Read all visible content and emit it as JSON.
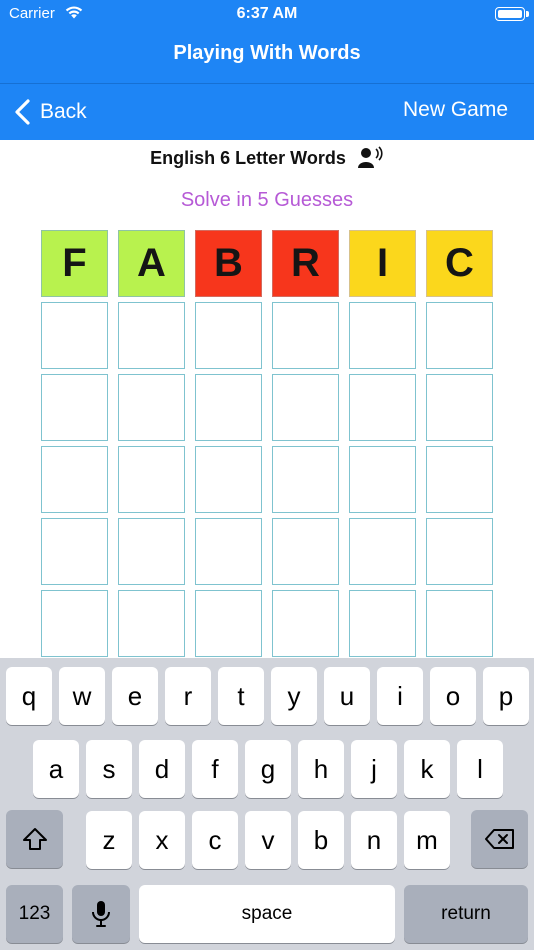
{
  "status_bar": {
    "carrier": "Carrier",
    "time": "6:37 AM"
  },
  "app": {
    "title": "Playing With Words"
  },
  "nav": {
    "back_label": "Back",
    "new_game_label": "New Game"
  },
  "game": {
    "subtitle": "English 6 Letter Words",
    "guesses_text": "Solve in 5 Guesses",
    "colors": {
      "green": "#b8f24e",
      "red": "#f7361c",
      "yellow": "#fbd71c",
      "accent": "#1e85f5",
      "guess_text": "#b65ad6"
    },
    "rows": [
      [
        {
          "letter": "F",
          "state": "green"
        },
        {
          "letter": "A",
          "state": "green"
        },
        {
          "letter": "B",
          "state": "red"
        },
        {
          "letter": "R",
          "state": "red"
        },
        {
          "letter": "I",
          "state": "yellow"
        },
        {
          "letter": "C",
          "state": "yellow"
        }
      ],
      [
        {
          "letter": "",
          "state": "empty"
        },
        {
          "letter": "",
          "state": "empty"
        },
        {
          "letter": "",
          "state": "empty"
        },
        {
          "letter": "",
          "state": "empty"
        },
        {
          "letter": "",
          "state": "empty"
        },
        {
          "letter": "",
          "state": "empty"
        }
      ],
      [
        {
          "letter": "",
          "state": "empty"
        },
        {
          "letter": "",
          "state": "empty"
        },
        {
          "letter": "",
          "state": "empty"
        },
        {
          "letter": "",
          "state": "empty"
        },
        {
          "letter": "",
          "state": "empty"
        },
        {
          "letter": "",
          "state": "empty"
        }
      ],
      [
        {
          "letter": "",
          "state": "empty"
        },
        {
          "letter": "",
          "state": "empty"
        },
        {
          "letter": "",
          "state": "empty"
        },
        {
          "letter": "",
          "state": "empty"
        },
        {
          "letter": "",
          "state": "empty"
        },
        {
          "letter": "",
          "state": "empty"
        }
      ],
      [
        {
          "letter": "",
          "state": "empty"
        },
        {
          "letter": "",
          "state": "empty"
        },
        {
          "letter": "",
          "state": "empty"
        },
        {
          "letter": "",
          "state": "empty"
        },
        {
          "letter": "",
          "state": "empty"
        },
        {
          "letter": "",
          "state": "empty"
        }
      ],
      [
        {
          "letter": "",
          "state": "empty"
        },
        {
          "letter": "",
          "state": "empty"
        },
        {
          "letter": "",
          "state": "empty"
        },
        {
          "letter": "",
          "state": "empty"
        },
        {
          "letter": "",
          "state": "empty"
        },
        {
          "letter": "",
          "state": "empty"
        }
      ]
    ]
  },
  "keyboard": {
    "row1": [
      "q",
      "w",
      "e",
      "r",
      "t",
      "y",
      "u",
      "i",
      "o",
      "p"
    ],
    "row2": [
      "a",
      "s",
      "d",
      "f",
      "g",
      "h",
      "j",
      "k",
      "l"
    ],
    "row3": [
      "z",
      "x",
      "c",
      "v",
      "b",
      "n",
      "m"
    ],
    "numbers_label": "123",
    "space_label": "space",
    "return_label": "return",
    "icons": {
      "shift": "shift-icon",
      "delete": "delete-icon",
      "mic": "microphone-icon"
    }
  }
}
